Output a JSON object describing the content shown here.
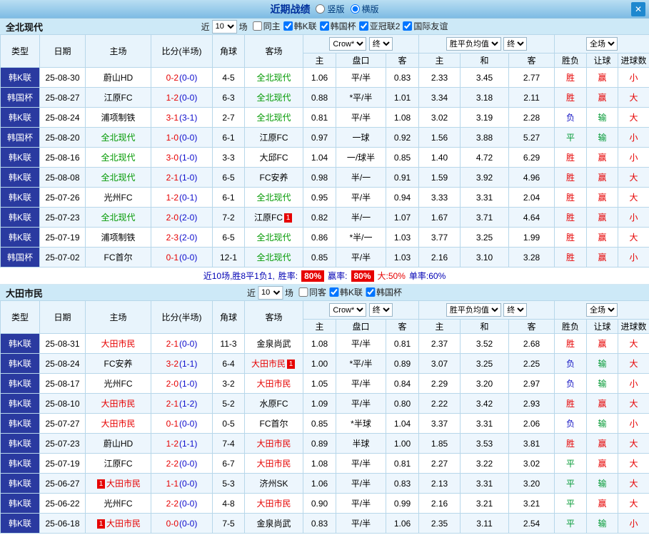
{
  "titlebar": {
    "title": "近期战绩",
    "radios": [
      {
        "label": "竖版",
        "selected": false
      },
      {
        "label": "横版",
        "selected": true
      }
    ],
    "close": "✕"
  },
  "result_colors": {
    "胜": "#e60000",
    "平": "#009933",
    "负": "#1515c4",
    "赢": "#e60000",
    "输": "#009933",
    "大": "#e60000",
    "小": "#e60000"
  },
  "sections": [
    {
      "team": "全北现代",
      "team_color": "#009900",
      "filter": {
        "prefix": "近",
        "count": "10",
        "suffix": "场",
        "options": [
          {
            "label": "同主",
            "checked": false
          },
          {
            "label": "韩K联",
            "checked": true
          },
          {
            "label": "韩国杯",
            "checked": true
          },
          {
            "label": "亚冠联2",
            "checked": true
          },
          {
            "label": "国际友谊",
            "checked": true
          }
        ]
      },
      "table": {
        "headers": {
          "type": "类型",
          "date": "日期",
          "home": "主场",
          "score": "比分(半场)",
          "corner": "角球",
          "away": "客场",
          "odds_select": "Crow*",
          "odds_final": "终",
          "odds_cols": [
            "主",
            "盘口",
            "客"
          ],
          "avg_select": "胜平负均值",
          "avg_final": "终",
          "avg_cols": [
            "主",
            "和",
            "客"
          ],
          "scope_select": "全场",
          "result_cols": [
            "胜负",
            "让球",
            "进球数"
          ]
        },
        "rows": [
          {
            "league": "韩K联",
            "date": "25-08-30",
            "home": "蔚山HD",
            "home_hl": false,
            "score_ft": "0-2",
            "score_ht": "(0-0)",
            "corner": "4-5",
            "away": "全北现代",
            "away_hl": true,
            "odds": [
              "1.06",
              "平/半",
              "0.83"
            ],
            "avg": [
              "2.33",
              "3.45",
              "2.77"
            ],
            "results": [
              "胜",
              "赢",
              "小"
            ]
          },
          {
            "league": "韩国杯",
            "date": "25-08-27",
            "home": "江原FC",
            "home_hl": false,
            "score_ft": "1-2",
            "score_ht": "(0-0)",
            "corner": "6-3",
            "away": "全北现代",
            "away_hl": true,
            "odds": [
              "0.88",
              "*平/半",
              "1.01"
            ],
            "avg": [
              "3.34",
              "3.18",
              "2.11"
            ],
            "results": [
              "胜",
              "赢",
              "大"
            ]
          },
          {
            "league": "韩K联",
            "date": "25-08-24",
            "home": "浦项制铁",
            "home_hl": false,
            "score_ft": "3-1",
            "score_ht": "(3-1)",
            "corner": "2-7",
            "away": "全北现代",
            "away_hl": true,
            "odds": [
              "0.81",
              "平/半",
              "1.08"
            ],
            "avg": [
              "3.02",
              "3.19",
              "2.28"
            ],
            "results": [
              "负",
              "输",
              "大"
            ]
          },
          {
            "league": "韩国杯",
            "date": "25-08-20",
            "home": "全北现代",
            "home_hl": true,
            "score_ft": "1-0",
            "score_ht": "(0-0)",
            "corner": "6-1",
            "away": "江原FC",
            "away_hl": false,
            "odds": [
              "0.97",
              "一球",
              "0.92"
            ],
            "avg": [
              "1.56",
              "3.88",
              "5.27"
            ],
            "results": [
              "平",
              "输",
              "小"
            ]
          },
          {
            "league": "韩K联",
            "date": "25-08-16",
            "home": "全北现代",
            "home_hl": true,
            "score_ft": "3-0",
            "score_ht": "(1-0)",
            "corner": "3-3",
            "away": "大邱FC",
            "away_hl": false,
            "odds": [
              "1.04",
              "一/球半",
              "0.85"
            ],
            "avg": [
              "1.40",
              "4.72",
              "6.29"
            ],
            "results": [
              "胜",
              "赢",
              "小"
            ]
          },
          {
            "league": "韩K联",
            "date": "25-08-08",
            "home": "全北现代",
            "home_hl": true,
            "score_ft": "2-1",
            "score_ht": "(1-0)",
            "corner": "6-5",
            "away": "FC安养",
            "away_hl": false,
            "odds": [
              "0.98",
              "半/一",
              "0.91"
            ],
            "avg": [
              "1.59",
              "3.92",
              "4.96"
            ],
            "results": [
              "胜",
              "赢",
              "大"
            ]
          },
          {
            "league": "韩K联",
            "date": "25-07-26",
            "home": "光州FC",
            "home_hl": false,
            "score_ft": "1-2",
            "score_ht": "(0-1)",
            "corner": "6-1",
            "away": "全北现代",
            "away_hl": true,
            "odds": [
              "0.95",
              "平/半",
              "0.94"
            ],
            "avg": [
              "3.33",
              "3.31",
              "2.04"
            ],
            "results": [
              "胜",
              "赢",
              "大"
            ]
          },
          {
            "league": "韩K联",
            "date": "25-07-23",
            "home": "全北现代",
            "home_hl": true,
            "score_ft": "2-0",
            "score_ht": "(2-0)",
            "corner": "7-2",
            "away": "江原FC",
            "away_hl": false,
            "away_card": "1",
            "away_card_pos": "r",
            "odds": [
              "0.82",
              "半/一",
              "1.07"
            ],
            "avg": [
              "1.67",
              "3.71",
              "4.64"
            ],
            "results": [
              "胜",
              "赢",
              "小"
            ]
          },
          {
            "league": "韩K联",
            "date": "25-07-19",
            "home": "浦项制铁",
            "home_hl": false,
            "score_ft": "2-3",
            "score_ht": "(2-0)",
            "corner": "6-5",
            "away": "全北现代",
            "away_hl": true,
            "odds": [
              "0.86",
              "*半/一",
              "1.03"
            ],
            "avg": [
              "3.77",
              "3.25",
              "1.99"
            ],
            "results": [
              "胜",
              "赢",
              "大"
            ]
          },
          {
            "league": "韩国杯",
            "date": "25-07-02",
            "home": "FC首尔",
            "home_hl": false,
            "score_ft": "0-1",
            "score_ht": "(0-0)",
            "corner": "12-1",
            "away": "全北现代",
            "away_hl": true,
            "odds": [
              "0.85",
              "平/半",
              "1.03"
            ],
            "avg": [
              "2.16",
              "3.10",
              "3.28"
            ],
            "results": [
              "胜",
              "赢",
              "小"
            ]
          }
        ]
      },
      "summary": {
        "prefix": "近10场,胜8平1负1,",
        "win_label": "胜率:",
        "win_rate": "80%",
        "handicap_label": "赢率:",
        "handicap_rate": "80%",
        "big": "大:50%",
        "odd": "单率:60%"
      }
    },
    {
      "team": "大田市民",
      "team_color": "#e60000",
      "filter": {
        "prefix": "近",
        "count": "10",
        "suffix": "场",
        "options": [
          {
            "label": "同客",
            "checked": false
          },
          {
            "label": "韩K联",
            "checked": true
          },
          {
            "label": "韩国杯",
            "checked": true
          }
        ]
      },
      "table": {
        "headers": {
          "type": "类型",
          "date": "日期",
          "home": "主场",
          "score": "比分(半场)",
          "corner": "角球",
          "away": "客场",
          "odds_select": "Crow*",
          "odds_final": "终",
          "odds_cols": [
            "主",
            "盘口",
            "客"
          ],
          "avg_select": "胜平负均值",
          "avg_final": "终",
          "avg_cols": [
            "主",
            "和",
            "客"
          ],
          "scope_select": "全场",
          "result_cols": [
            "胜负",
            "让球",
            "进球数"
          ]
        },
        "rows": [
          {
            "league": "韩K联",
            "date": "25-08-31",
            "home": "大田市民",
            "home_hl": true,
            "score_ft": "2-1",
            "score_ht": "(0-0)",
            "corner": "11-3",
            "away": "金泉尚武",
            "away_hl": false,
            "odds": [
              "1.08",
              "平/半",
              "0.81"
            ],
            "avg": [
              "2.37",
              "3.52",
              "2.68"
            ],
            "results": [
              "胜",
              "赢",
              "大"
            ]
          },
          {
            "league": "韩K联",
            "date": "25-08-24",
            "home": "FC安养",
            "home_hl": false,
            "score_ft": "3-2",
            "score_ht": "(1-1)",
            "corner": "6-4",
            "away": "大田市民",
            "away_hl": true,
            "away_card": "1",
            "away_card_pos": "r",
            "odds": [
              "1.00",
              "*平/半",
              "0.89"
            ],
            "avg": [
              "3.07",
              "3.25",
              "2.25"
            ],
            "results": [
              "负",
              "输",
              "大"
            ]
          },
          {
            "league": "韩K联",
            "date": "25-08-17",
            "home": "光州FC",
            "home_hl": false,
            "score_ft": "2-0",
            "score_ht": "(1-0)",
            "corner": "3-2",
            "away": "大田市民",
            "away_hl": true,
            "odds": [
              "1.05",
              "平/半",
              "0.84"
            ],
            "avg": [
              "2.29",
              "3.20",
              "2.97"
            ],
            "results": [
              "负",
              "输",
              "小"
            ]
          },
          {
            "league": "韩K联",
            "date": "25-08-10",
            "home": "大田市民",
            "home_hl": true,
            "score_ft": "2-1",
            "score_ht": "(1-2)",
            "corner": "5-2",
            "away": "水原FC",
            "away_hl": false,
            "odds": [
              "1.09",
              "平/半",
              "0.80"
            ],
            "avg": [
              "2.22",
              "3.42",
              "2.93"
            ],
            "results": [
              "胜",
              "赢",
              "大"
            ]
          },
          {
            "league": "韩K联",
            "date": "25-07-27",
            "home": "大田市民",
            "home_hl": true,
            "score_ft": "0-1",
            "score_ht": "(0-0)",
            "corner": "0-5",
            "away": "FC首尔",
            "away_hl": false,
            "odds": [
              "0.85",
              "*半球",
              "1.04"
            ],
            "avg": [
              "3.37",
              "3.31",
              "2.06"
            ],
            "results": [
              "负",
              "输",
              "小"
            ]
          },
          {
            "league": "韩K联",
            "date": "25-07-23",
            "home": "蔚山HD",
            "home_hl": false,
            "score_ft": "1-2",
            "score_ht": "(1-1)",
            "corner": "7-4",
            "away": "大田市民",
            "away_hl": true,
            "odds": [
              "0.89",
              "半球",
              "1.00"
            ],
            "avg": [
              "1.85",
              "3.53",
              "3.81"
            ],
            "results": [
              "胜",
              "赢",
              "大"
            ]
          },
          {
            "league": "韩K联",
            "date": "25-07-19",
            "home": "江原FC",
            "home_hl": false,
            "score_ft": "2-2",
            "score_ht": "(0-0)",
            "corner": "6-7",
            "away": "大田市民",
            "away_hl": true,
            "odds": [
              "1.08",
              "平/半",
              "0.81"
            ],
            "avg": [
              "2.27",
              "3.22",
              "3.02"
            ],
            "results": [
              "平",
              "赢",
              "大"
            ]
          },
          {
            "league": "韩K联",
            "date": "25-06-27",
            "home": "大田市民",
            "home_hl": true,
            "home_card": "1",
            "home_card_pos": "l",
            "score_ft": "1-1",
            "score_ht": "(0-0)",
            "corner": "5-3",
            "away": "济州SK",
            "away_hl": false,
            "odds": [
              "1.06",
              "平/半",
              "0.83"
            ],
            "avg": [
              "2.13",
              "3.31",
              "3.20"
            ],
            "results": [
              "平",
              "输",
              "大"
            ]
          },
          {
            "league": "韩K联",
            "date": "25-06-22",
            "home": "光州FC",
            "home_hl": false,
            "score_ft": "2-2",
            "score_ht": "(0-0)",
            "corner": "4-8",
            "away": "大田市民",
            "away_hl": true,
            "odds": [
              "0.90",
              "平/半",
              "0.99"
            ],
            "avg": [
              "2.16",
              "3.21",
              "3.21"
            ],
            "results": [
              "平",
              "赢",
              "大"
            ]
          },
          {
            "league": "韩K联",
            "date": "25-06-18",
            "home": "大田市民",
            "home_hl": true,
            "home_card": "1",
            "home_card_pos": "l",
            "score_ft": "0-0",
            "score_ht": "(0-0)",
            "corner": "7-5",
            "away": "金泉尚武",
            "away_hl": false,
            "odds": [
              "0.83",
              "平/半",
              "1.06"
            ],
            "avg": [
              "2.35",
              "3.11",
              "2.54"
            ],
            "results": [
              "平",
              "输",
              "小"
            ]
          }
        ]
      }
    }
  ]
}
